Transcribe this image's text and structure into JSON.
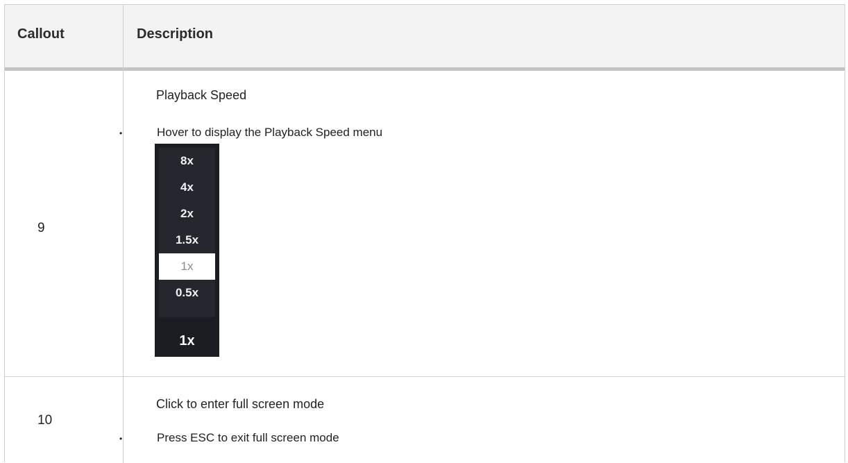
{
  "table": {
    "headers": {
      "callout": "Callout",
      "description": "Description"
    },
    "rows": [
      {
        "callout": "9",
        "title": "Playback Speed",
        "bullet": "•",
        "bullet_text": "Hover to display the Playback Speed menu"
      },
      {
        "callout": "10",
        "title": "Click to enter full screen mode",
        "bullet": "•",
        "bullet_text": "Press ESC to exit full screen mode"
      }
    ]
  },
  "speed_menu": {
    "options": [
      "8x",
      "4x",
      "2x",
      "1.5x",
      "1x",
      "0.5x"
    ],
    "selected": "1x",
    "current_label": "1x"
  }
}
